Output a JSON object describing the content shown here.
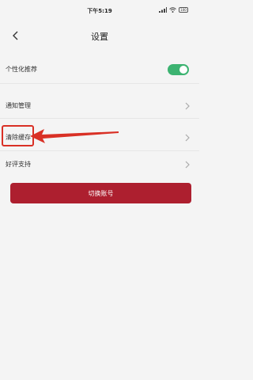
{
  "status_bar": {
    "time": "下午5:19",
    "battery": "100"
  },
  "header": {
    "title": "设置"
  },
  "settings": {
    "personalized": {
      "label": "个性化推荐",
      "enabled": true
    },
    "items": [
      {
        "label": "通知管理"
      },
      {
        "label": "清除缓存"
      },
      {
        "label": "好评支持"
      }
    ]
  },
  "account": {
    "switch_label": "切换账号"
  },
  "colors": {
    "accent": "#ad1f2f",
    "toggle_on": "#3cb371",
    "annotation": "#d93025"
  },
  "icons": [
    "back-arrow-icon",
    "chevron-right-icon",
    "signal-icon",
    "wifi-icon",
    "battery-icon"
  ]
}
